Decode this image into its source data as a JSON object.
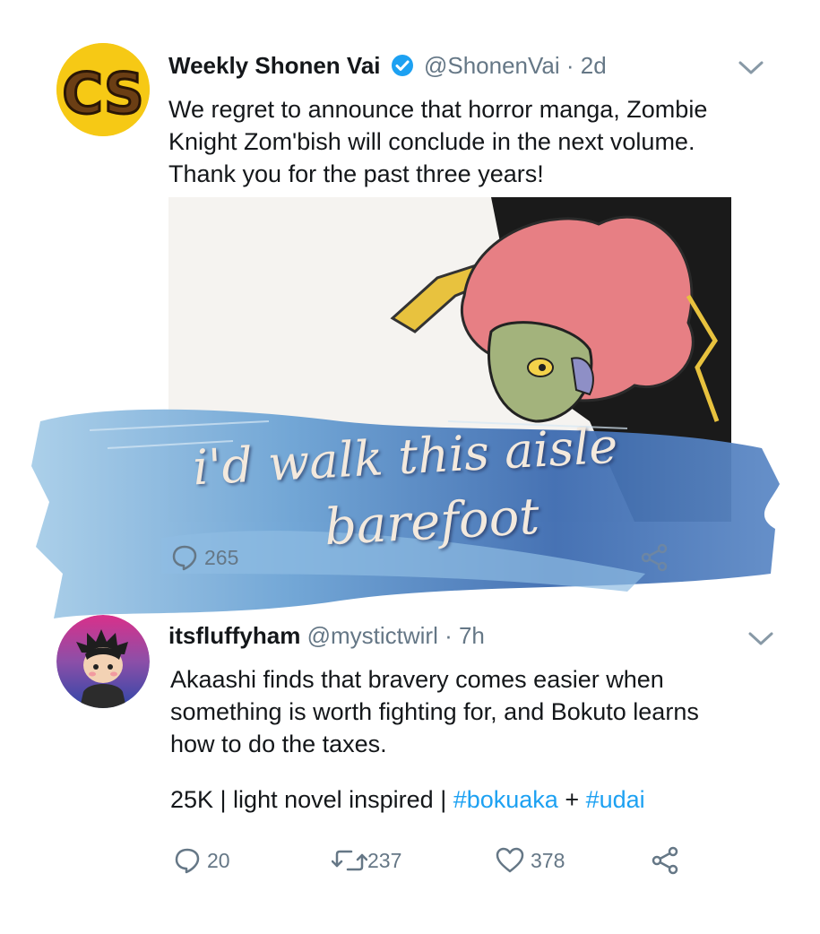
{
  "tweet1": {
    "avatar_text": "CS",
    "display_name": "Weekly Shonen Vai",
    "handle_time": "@ShonenVai · 2d",
    "text_lines": [
      "We regret to announce that horror manga, Zombie",
      "Knight Zom'bish will conclude in the next volume.",
      "Thank you for the past three years!"
    ],
    "reply_count": "265"
  },
  "overlay": {
    "line1": "i'd walk this aisle",
    "line2": "barefoot"
  },
  "tweet2": {
    "display_name": "itsfluffyham",
    "handle_time": "@mystictwirl · 7h",
    "text_lines": [
      "Akaashi finds that bravery comes easier when",
      "something is worth fighting for, and Bokuto learns",
      "how to do the taxes."
    ],
    "meta_prefix": "25K | light novel inspired | ",
    "hashtag1": "#bokuaka",
    "plus": " + ",
    "hashtag2": "#udai",
    "reply_count": "20",
    "retweet_count": "237",
    "like_count": "378"
  },
  "colors": {
    "verified": "#1da1f2",
    "hashtag": "#1da1f2",
    "secondary": "#657786",
    "brush_blue": "#3f6fb5",
    "avatar_yellow": "#f6c915"
  },
  "icons": [
    "verified-badge-icon",
    "chevron-down-icon",
    "reply-icon",
    "retweet-icon",
    "like-icon",
    "share-icon"
  ]
}
